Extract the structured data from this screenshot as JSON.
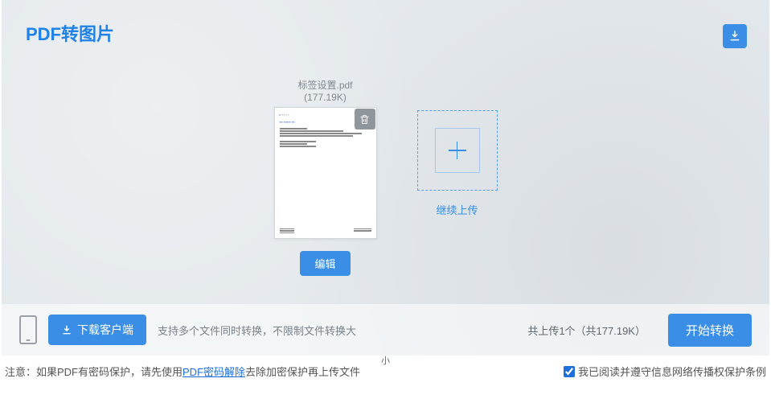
{
  "title": "PDF转图片",
  "file": {
    "name": "标签设置.pdf",
    "size": "(177.19K)",
    "editLabel": "编辑"
  },
  "addMore": "继续上传",
  "bottom": {
    "downloadClient": "下载客户端",
    "tip": "支持多个文件同时转换，不限制文件转换大",
    "summary": "共上传1个（共177.19K）",
    "start": "开始转换",
    "smallHint": "小"
  },
  "notice": {
    "prefix": "注意：如果PDF有密码保护，请先使用 ",
    "link": "PDF密码解除",
    "suffix": " 去除加密保护再上传文件",
    "agree": "我已阅读并遵守信息网络传播权保护条例"
  }
}
